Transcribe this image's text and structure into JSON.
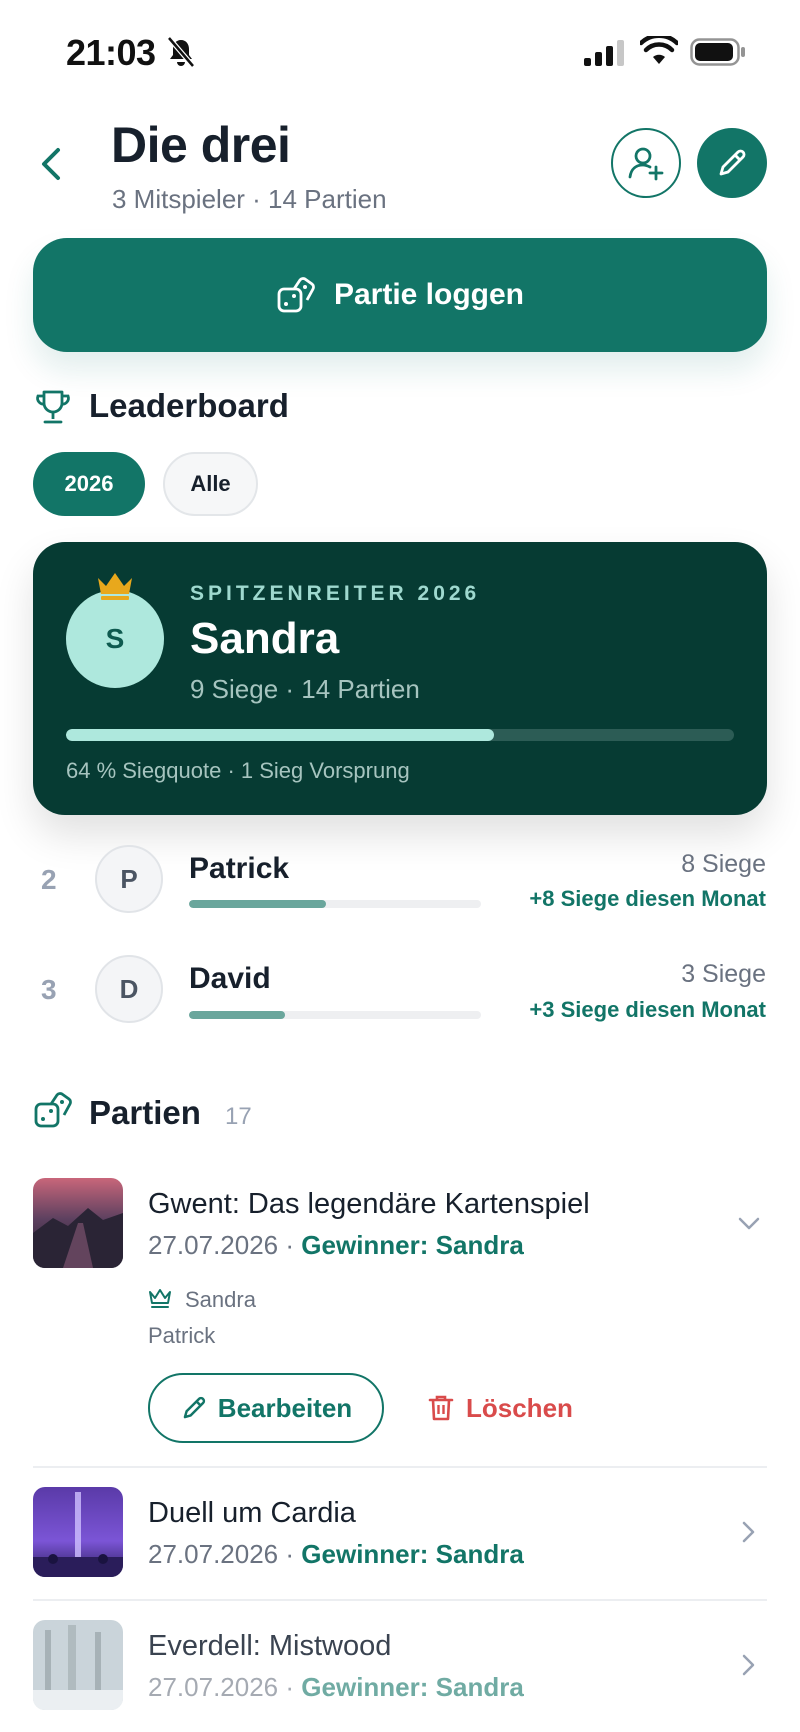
{
  "status_bar": {
    "time": "21:03"
  },
  "header": {
    "title": "Die drei",
    "subtitle": "3 Mitspieler · 14 Partien"
  },
  "actions": {
    "log_game_label": "Partie loggen"
  },
  "leaderboard": {
    "title": "Leaderboard",
    "filters": [
      {
        "label": "2026",
        "active": true
      },
      {
        "label": "Alle",
        "active": false
      }
    ],
    "leader": {
      "kicker": "SPITZENREITER 2026",
      "initial": "S",
      "name": "Sandra",
      "stats": "9 Siege · 14 Partien",
      "win_rate": 0.64,
      "footer": "64 % Siegquote · 1 Sieg Vorsprung"
    },
    "others": [
      {
        "rank": "2",
        "initial": "P",
        "name": "Patrick",
        "wins": "8 Siege",
        "month": "+8 Siege diesen Monat",
        "progress": 0.47
      },
      {
        "rank": "3",
        "initial": "D",
        "name": "David",
        "wins": "3 Siege",
        "month": "+3 Siege diesen Monat",
        "progress": 0.33
      }
    ]
  },
  "games_section": {
    "title": "Partien",
    "count": "17",
    "games": [
      {
        "title": "Gwent: Das legendäre Kartenspiel",
        "date": "27.07.2026",
        "separator": "·",
        "winner": "Gewinner: Sandra",
        "expanded": true,
        "players": [
          "Sandra",
          "Patrick"
        ],
        "edit_label": "Bearbeiten",
        "delete_label": "Löschen"
      },
      {
        "title": "Duell um Cardia",
        "date": "27.07.2026",
        "separator": "·",
        "winner": "Gewinner: Sandra"
      },
      {
        "title": "Everdell: Mistwood",
        "date": "27.07.2026",
        "separator": "·",
        "winner": "Gewinner: Sandra"
      }
    ]
  },
  "colors": {
    "brand": "#127567",
    "leader_card": "#063b33",
    "accent_light": "#aee8dd",
    "danger": "#d94b4b",
    "crown": "#e8a81c"
  }
}
